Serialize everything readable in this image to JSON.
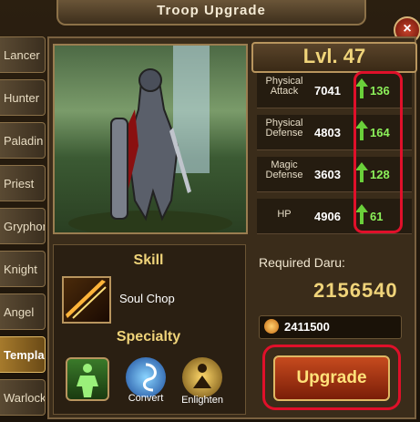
{
  "window": {
    "title": "Troop Upgrade",
    "close_label": "×"
  },
  "sidebar": {
    "items": [
      {
        "label": "Lancer",
        "active": false
      },
      {
        "label": "Hunter",
        "active": false
      },
      {
        "label": "Paladin",
        "active": false
      },
      {
        "label": "Priest",
        "active": false
      },
      {
        "label": "Gryphon",
        "active": false
      },
      {
        "label": "Knight",
        "active": false
      },
      {
        "label": "Angel",
        "active": false
      },
      {
        "label": "Templar",
        "active": true
      },
      {
        "label": "Warlock",
        "active": false
      }
    ]
  },
  "level": {
    "text": "Lvl. 47"
  },
  "stats": [
    {
      "label": "Physical Attack",
      "value": "7041",
      "increase": "136"
    },
    {
      "label": "Physical Defense",
      "value": "4803",
      "increase": "164"
    },
    {
      "label": "Magic Defense",
      "value": "3603",
      "increase": "128"
    },
    {
      "label": "HP",
      "value": "4906",
      "increase": "61"
    }
  ],
  "skill": {
    "title": "Skill",
    "name": "Soul Chop"
  },
  "specialty": {
    "title": "Specialty",
    "items": [
      {
        "label": "",
        "icon": "figure-icon"
      },
      {
        "label": "Convert",
        "icon": "convert-icon"
      },
      {
        "label": "Enlighten",
        "icon": "enlighten-icon"
      }
    ]
  },
  "cost": {
    "label": "Required Daru:",
    "value": "2156540",
    "owned": "2411500"
  },
  "actions": {
    "upgrade_label": "Upgrade"
  },
  "colors": {
    "accent": "#f0d47a",
    "highlight": "#e0102a",
    "increase": "#8cf05a"
  }
}
